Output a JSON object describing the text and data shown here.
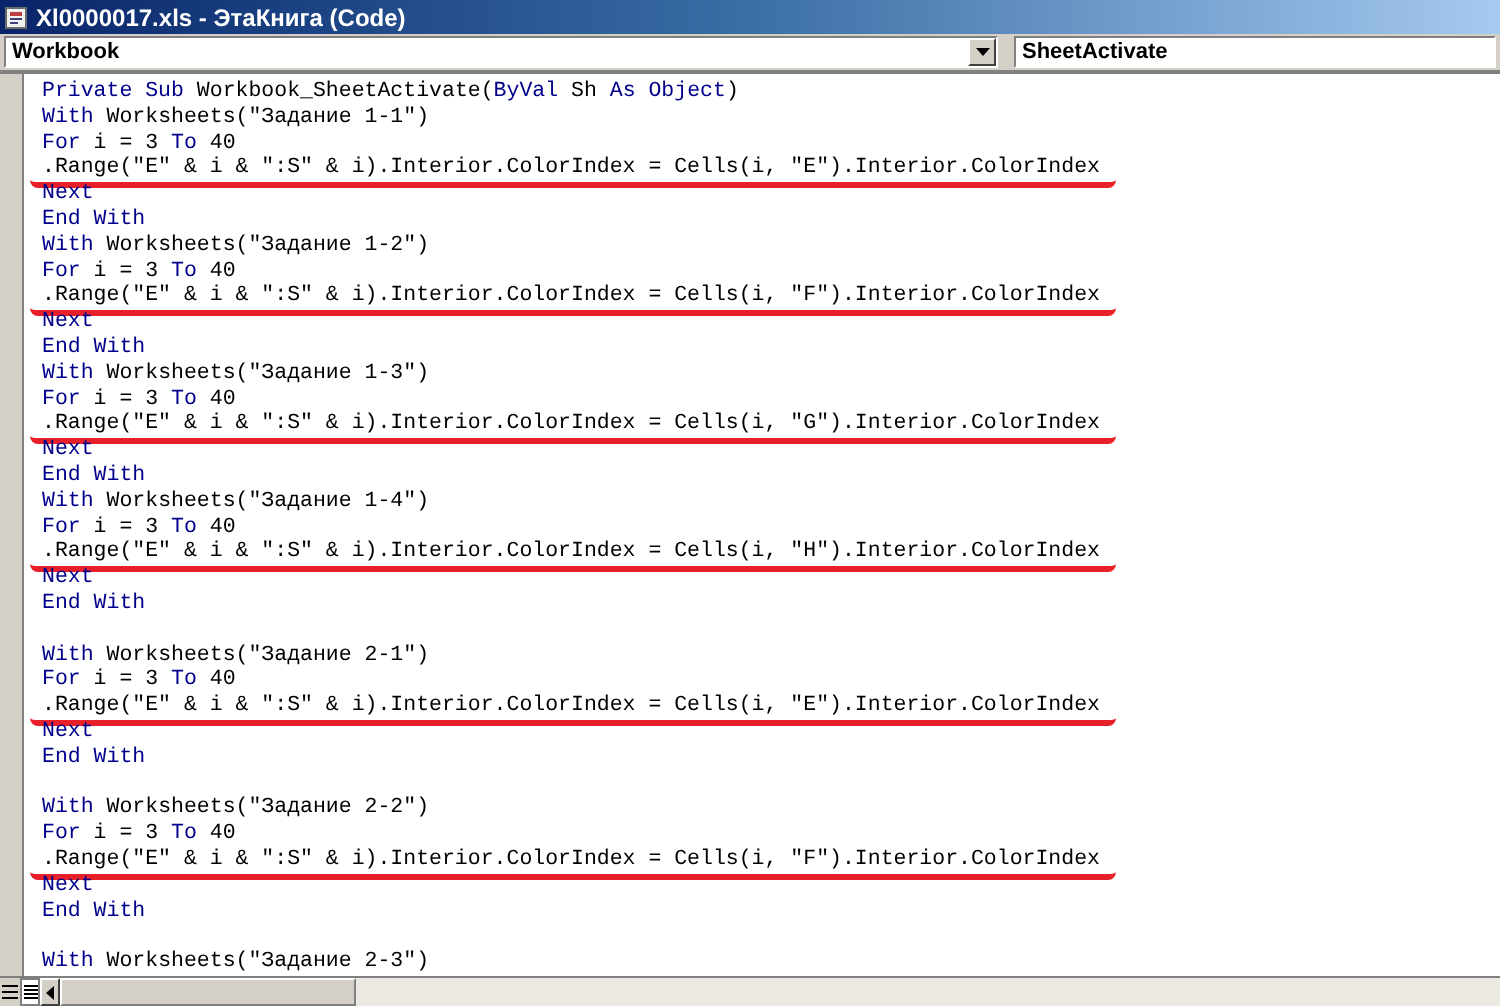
{
  "window": {
    "title": "Xl0000017.xls - ЭтаКнига (Code)"
  },
  "object_combo": {
    "value": "Workbook"
  },
  "procedure_combo": {
    "value": "SheetActivate"
  },
  "code": {
    "lines": [
      {
        "kind": "code",
        "underlined": false,
        "parts": [
          {
            "text": "Private Sub",
            "kind": "keyword"
          },
          {
            "text": " Workbook_SheetActivate(",
            "kind": "plain"
          },
          {
            "text": "ByVal",
            "kind": "keyword"
          },
          {
            "text": " Sh ",
            "kind": "plain"
          },
          {
            "text": "As Object",
            "kind": "keyword"
          },
          {
            "text": ")",
            "kind": "plain"
          }
        ]
      },
      {
        "kind": "code",
        "underlined": false,
        "parts": [
          {
            "text": "With",
            "kind": "keyword"
          },
          {
            "text": " Worksheets(\"Задание 1-1\")",
            "kind": "plain"
          }
        ]
      },
      {
        "kind": "code",
        "underlined": false,
        "parts": [
          {
            "text": "For",
            "kind": "keyword"
          },
          {
            "text": " i = 3 ",
            "kind": "plain"
          },
          {
            "text": "To",
            "kind": "keyword"
          },
          {
            "text": " 40",
            "kind": "plain"
          }
        ]
      },
      {
        "kind": "code",
        "underlined": true,
        "parts": [
          {
            "text": ".Range(\"E\" & i & \":S\" & i).Interior.ColorIndex = Cells(i, \"E\").Interior.ColorIndex",
            "kind": "plain"
          }
        ]
      },
      {
        "kind": "code",
        "underlined": false,
        "parts": [
          {
            "text": "Next",
            "kind": "keyword"
          }
        ]
      },
      {
        "kind": "code",
        "underlined": false,
        "parts": [
          {
            "text": "End With",
            "kind": "keyword"
          }
        ]
      },
      {
        "kind": "code",
        "underlined": false,
        "parts": [
          {
            "text": "With",
            "kind": "keyword"
          },
          {
            "text": " Worksheets(\"Задание 1-2\")",
            "kind": "plain"
          }
        ]
      },
      {
        "kind": "code",
        "underlined": false,
        "parts": [
          {
            "text": "For",
            "kind": "keyword"
          },
          {
            "text": " i = 3 ",
            "kind": "plain"
          },
          {
            "text": "To",
            "kind": "keyword"
          },
          {
            "text": " 40",
            "kind": "plain"
          }
        ]
      },
      {
        "kind": "code",
        "underlined": true,
        "parts": [
          {
            "text": ".Range(\"E\" & i & \":S\" & i).Interior.ColorIndex = Cells(i, \"F\").Interior.ColorIndex",
            "kind": "plain"
          }
        ]
      },
      {
        "kind": "code",
        "underlined": false,
        "parts": [
          {
            "text": "Next",
            "kind": "keyword"
          }
        ]
      },
      {
        "kind": "code",
        "underlined": false,
        "parts": [
          {
            "text": "End With",
            "kind": "keyword"
          }
        ]
      },
      {
        "kind": "code",
        "underlined": false,
        "parts": [
          {
            "text": "With",
            "kind": "keyword"
          },
          {
            "text": " Worksheets(\"Задание 1-3\")",
            "kind": "plain"
          }
        ]
      },
      {
        "kind": "code",
        "underlined": false,
        "parts": [
          {
            "text": "For",
            "kind": "keyword"
          },
          {
            "text": " i = 3 ",
            "kind": "plain"
          },
          {
            "text": "To",
            "kind": "keyword"
          },
          {
            "text": " 40",
            "kind": "plain"
          }
        ]
      },
      {
        "kind": "code",
        "underlined": true,
        "parts": [
          {
            "text": ".Range(\"E\" & i & \":S\" & i).Interior.ColorIndex = Cells(i, \"G\").Interior.ColorIndex",
            "kind": "plain"
          }
        ]
      },
      {
        "kind": "code",
        "underlined": false,
        "parts": [
          {
            "text": "Next",
            "kind": "keyword"
          }
        ]
      },
      {
        "kind": "code",
        "underlined": false,
        "parts": [
          {
            "text": "End With",
            "kind": "keyword"
          }
        ]
      },
      {
        "kind": "code",
        "underlined": false,
        "parts": [
          {
            "text": "With",
            "kind": "keyword"
          },
          {
            "text": " Worksheets(\"Задание 1-4\")",
            "kind": "plain"
          }
        ]
      },
      {
        "kind": "code",
        "underlined": false,
        "parts": [
          {
            "text": "For",
            "kind": "keyword"
          },
          {
            "text": " i = 3 ",
            "kind": "plain"
          },
          {
            "text": "To",
            "kind": "keyword"
          },
          {
            "text": " 40",
            "kind": "plain"
          }
        ]
      },
      {
        "kind": "code",
        "underlined": true,
        "parts": [
          {
            "text": ".Range(\"E\" & i & \":S\" & i).Interior.ColorIndex = Cells(i, \"H\").Interior.ColorIndex",
            "kind": "plain"
          }
        ]
      },
      {
        "kind": "code",
        "underlined": false,
        "parts": [
          {
            "text": "Next",
            "kind": "keyword"
          }
        ]
      },
      {
        "kind": "code",
        "underlined": false,
        "parts": [
          {
            "text": "End With",
            "kind": "keyword"
          }
        ]
      },
      {
        "kind": "blank"
      },
      {
        "kind": "code",
        "underlined": false,
        "parts": [
          {
            "text": "With",
            "kind": "keyword"
          },
          {
            "text": " Worksheets(\"Задание 2-1\")",
            "kind": "plain"
          }
        ]
      },
      {
        "kind": "code",
        "underlined": false,
        "parts": [
          {
            "text": "For",
            "kind": "keyword"
          },
          {
            "text": " i = 3 ",
            "kind": "plain"
          },
          {
            "text": "To",
            "kind": "keyword"
          },
          {
            "text": " 40",
            "kind": "plain"
          }
        ]
      },
      {
        "kind": "code",
        "underlined": true,
        "parts": [
          {
            "text": ".Range(\"E\" & i & \":S\" & i).Interior.ColorIndex = Cells(i, \"E\").Interior.ColorIndex",
            "kind": "plain"
          }
        ]
      },
      {
        "kind": "code",
        "underlined": false,
        "parts": [
          {
            "text": "Next",
            "kind": "keyword"
          }
        ]
      },
      {
        "kind": "code",
        "underlined": false,
        "parts": [
          {
            "text": "End With",
            "kind": "keyword"
          }
        ]
      },
      {
        "kind": "blank"
      },
      {
        "kind": "code",
        "underlined": false,
        "parts": [
          {
            "text": "With",
            "kind": "keyword"
          },
          {
            "text": " Worksheets(\"Задание 2-2\")",
            "kind": "plain"
          }
        ]
      },
      {
        "kind": "code",
        "underlined": false,
        "parts": [
          {
            "text": "For",
            "kind": "keyword"
          },
          {
            "text": " i = 3 ",
            "kind": "plain"
          },
          {
            "text": "To",
            "kind": "keyword"
          },
          {
            "text": " 40",
            "kind": "plain"
          }
        ]
      },
      {
        "kind": "code",
        "underlined": true,
        "parts": [
          {
            "text": ".Range(\"E\" & i & \":S\" & i).Interior.ColorIndex = Cells(i, \"F\").Interior.ColorIndex",
            "kind": "plain"
          }
        ]
      },
      {
        "kind": "code",
        "underlined": false,
        "parts": [
          {
            "text": "Next",
            "kind": "keyword"
          }
        ]
      },
      {
        "kind": "code",
        "underlined": false,
        "parts": [
          {
            "text": "End With",
            "kind": "keyword"
          }
        ]
      },
      {
        "kind": "blank"
      },
      {
        "kind": "code",
        "underlined": false,
        "parts": [
          {
            "text": "With",
            "kind": "keyword"
          },
          {
            "text": " Worksheets(\"Задание 2-3\")",
            "kind": "plain"
          }
        ]
      }
    ]
  }
}
